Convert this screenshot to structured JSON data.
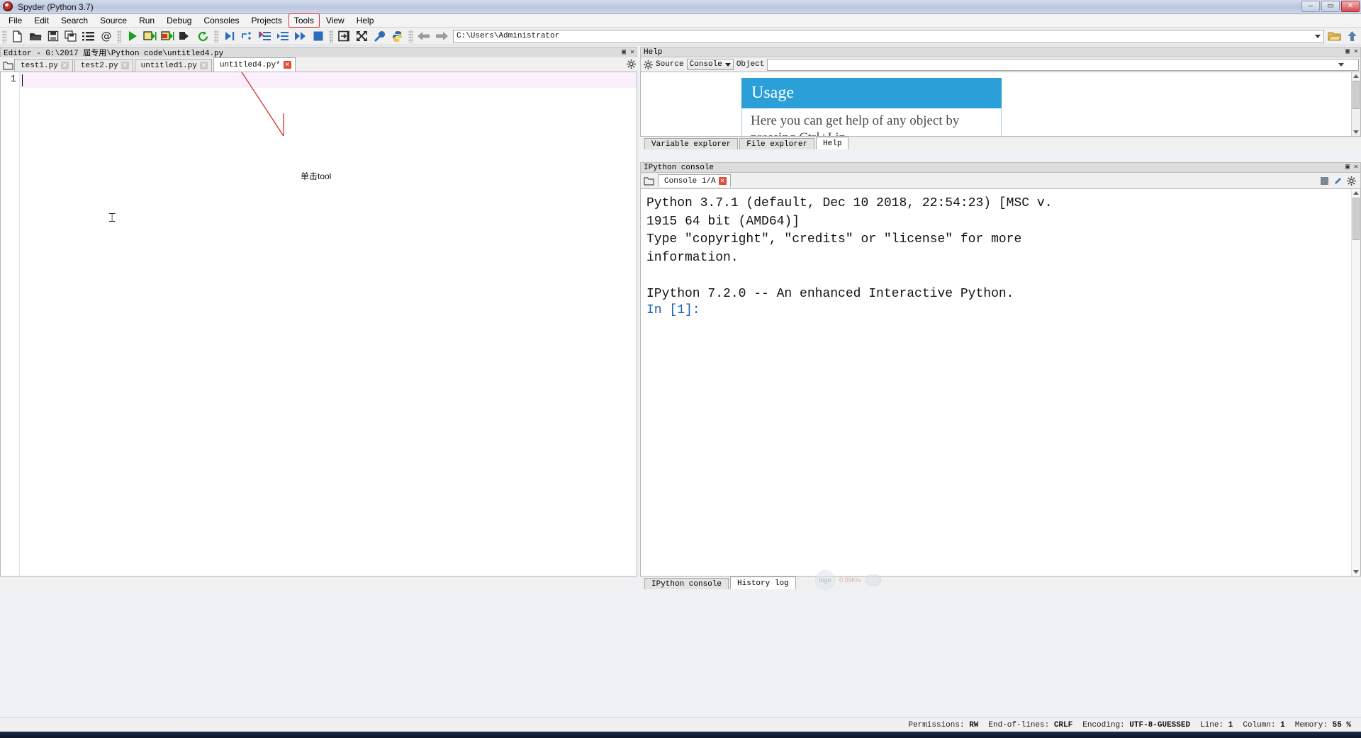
{
  "window": {
    "title": "Spyder (Python 3.7)",
    "min_label": "–",
    "max_label": "▭",
    "close_label": "✕"
  },
  "menubar": {
    "items": [
      {
        "label": "File",
        "highlight": false
      },
      {
        "label": "Edit",
        "highlight": false
      },
      {
        "label": "Search",
        "highlight": false
      },
      {
        "label": "Source",
        "highlight": false
      },
      {
        "label": "Run",
        "highlight": false
      },
      {
        "label": "Debug",
        "highlight": false
      },
      {
        "label": "Consoles",
        "highlight": false
      },
      {
        "label": "Projects",
        "highlight": false
      },
      {
        "label": "Tools",
        "highlight": true
      },
      {
        "label": "View",
        "highlight": false
      },
      {
        "label": "Help",
        "highlight": false
      }
    ],
    "highlight_color": "#e03030"
  },
  "toolbar": {
    "icons": [
      "new-file-icon",
      "open-file-icon",
      "save-file-icon",
      "save-all-icon",
      "file-list-icon",
      "at-sign-icon",
      "run-icon",
      "run-cell-icon",
      "run-cell-advance-icon",
      "run-selection-icon",
      "re-run-icon",
      "debug-icon",
      "step-over-icon",
      "step-into-icon",
      "step-return-icon",
      "continue-icon",
      "stop-icon",
      "maximize-pane-icon",
      "fullscreen-icon",
      "preferences-wrench-icon",
      "pythonpath-icon",
      "back-arrow-icon",
      "forward-arrow-icon"
    ],
    "path_value": "C:\\Users\\Administrator",
    "path_dropdown": "chevron-down-icon",
    "browse_icon": "folder-open-icon",
    "up_icon": "arrow-up-icon"
  },
  "editor": {
    "pane_title": "Editor - G:\\2017 届专用\\Python code\\untitled4.py",
    "undock_label": "▣",
    "close_label": "✕",
    "options_icon": "gear-icon",
    "browse_tabs_icon": "folder-icon",
    "tabs": [
      {
        "label": "test1.py",
        "active": false,
        "modified": false
      },
      {
        "label": "test2.py",
        "active": false,
        "modified": false
      },
      {
        "label": "untitled1.py",
        "active": false,
        "modified": false
      },
      {
        "label": "untitled4.py*",
        "active": true,
        "modified": true
      }
    ],
    "line_numbers": [
      "1"
    ],
    "code_lines": [
      ""
    ],
    "annotation": "单击tool"
  },
  "help": {
    "pane_title": "Help",
    "undock_label": "▣",
    "close_label": "✕",
    "options_icon": "gear-icon",
    "source_label": "Source",
    "source_value": "Console",
    "object_label": "Object",
    "object_value": "",
    "usage_title": "Usage",
    "usage_text": "Here you can get help of any object by pressing Ctrl+I in",
    "accent_color": "#2a9fd8",
    "tabs": [
      {
        "label": "Variable explorer",
        "active": false
      },
      {
        "label": "File explorer",
        "active": false
      },
      {
        "label": "Help",
        "active": true
      }
    ]
  },
  "console": {
    "pane_title": "IPython console",
    "undock_label": "▣",
    "close_label": "✕",
    "browse_icon": "folder-icon",
    "tab_label": "Console 1/A",
    "tab_close": "✕",
    "options_icon": "gear-icon",
    "stop_icon": "stop-square-icon",
    "pencil_icon": "pencil-icon",
    "output": "Python 3.7.1 (default, Dec 10 2018, 22:54:23) [MSC v.\n1915 64 bit (AMD64)]\nType \"copyright\", \"credits\" or \"license\" for more\ninformation.\n\nIPython 7.2.0 -- An enhanced Interactive Python.\n",
    "prompt": "In [1]:",
    "prompt_color": "#1a5fb4",
    "tabs": [
      {
        "label": "IPython console",
        "active": false
      },
      {
        "label": "History log",
        "active": true
      }
    ]
  },
  "statusbar": {
    "permissions_key": "Permissions:",
    "permissions_value": "RW",
    "eol_key": "End-of-lines:",
    "eol_value": "CRLF",
    "encoding_key": "Encoding:",
    "encoding_value": "UTF-8-GUESSED",
    "line_key": "Line:",
    "line_value": "1",
    "column_key": "Column:",
    "column_value": "1",
    "memory_key": "Memory:",
    "memory_value": "55 %"
  },
  "watermark": {
    "speed": "0.09K/s",
    "badge": "logo"
  }
}
